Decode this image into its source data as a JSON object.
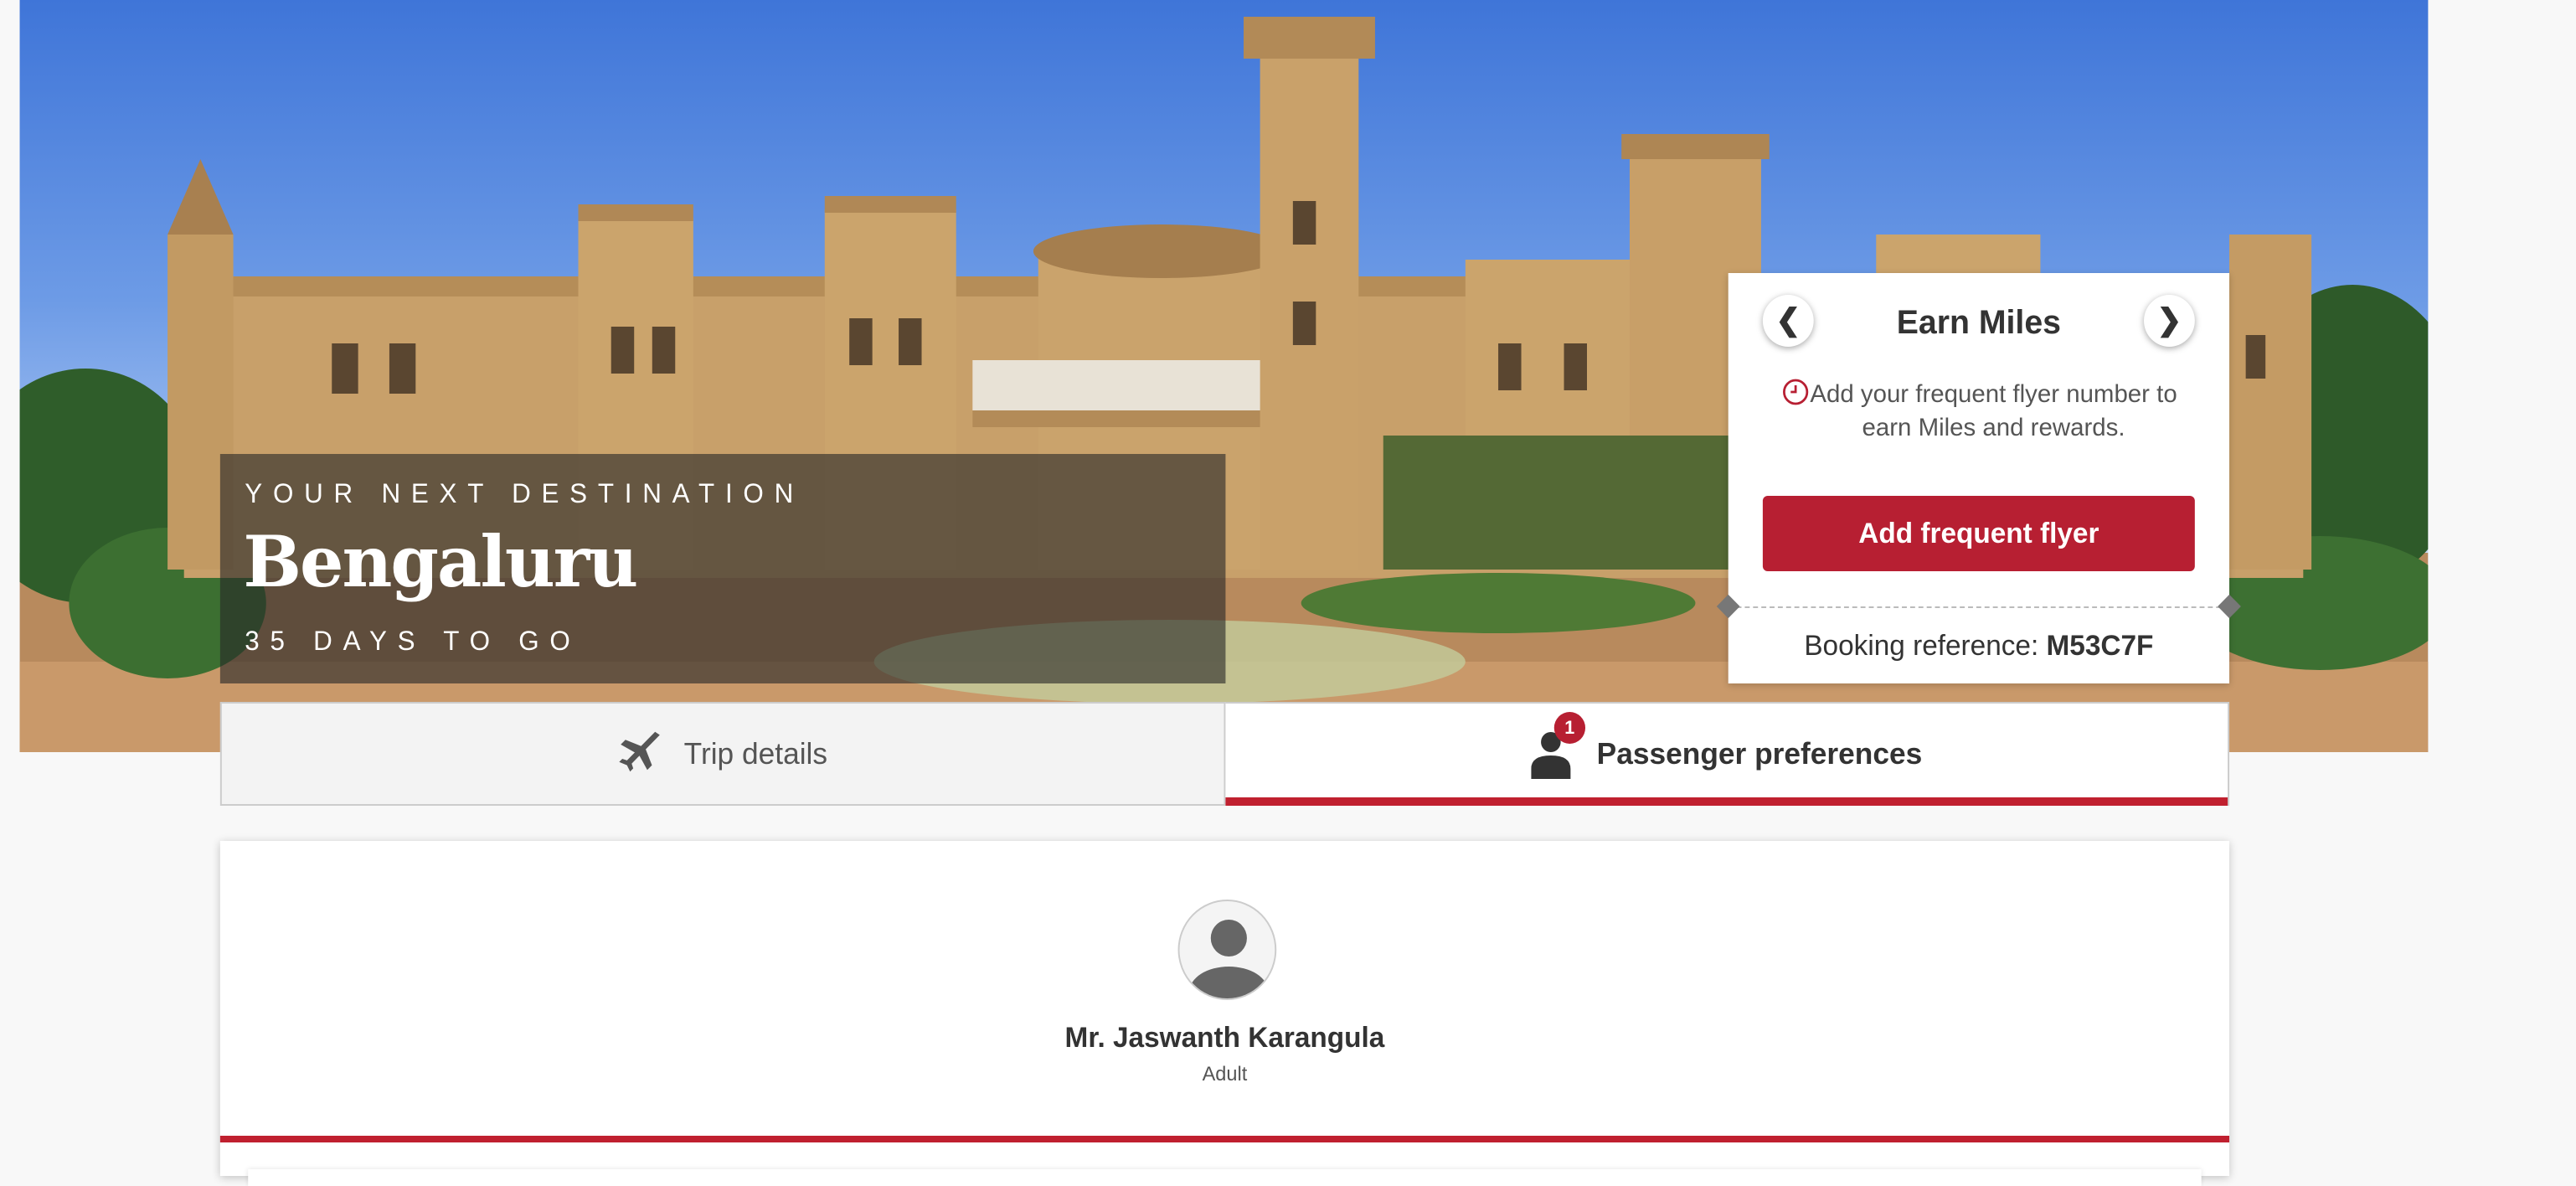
{
  "hero": {
    "eyebrow": "YOUR NEXT DESTINATION",
    "city": "Bengaluru",
    "countdown": "35 DAYS TO GO"
  },
  "earn_card": {
    "prev_icon": "chevron-left-icon",
    "next_icon": "chevron-right-icon",
    "prev_glyph": "❮",
    "next_glyph": "❯",
    "title": "Earn Miles",
    "description": "Add your frequent flyer number to earn Miles and rewards.",
    "cta_label": "Add frequent flyer",
    "booking_ref_label": "Booking reference: ",
    "booking_ref_value": "M53C7F"
  },
  "tabs": [
    {
      "label": "Trip details",
      "icon": "airplane-icon",
      "active": false
    },
    {
      "label": "Passenger preferences",
      "icon": "person-icon",
      "active": true,
      "badge": "1"
    }
  ],
  "passenger": {
    "name": "Mr. Jaswanth Karangula",
    "type": "Adult"
  },
  "colors": {
    "accent": "#b71f32",
    "active_underline": "#c0202f",
    "overlay": "rgba(40,40,40,0.62)"
  }
}
